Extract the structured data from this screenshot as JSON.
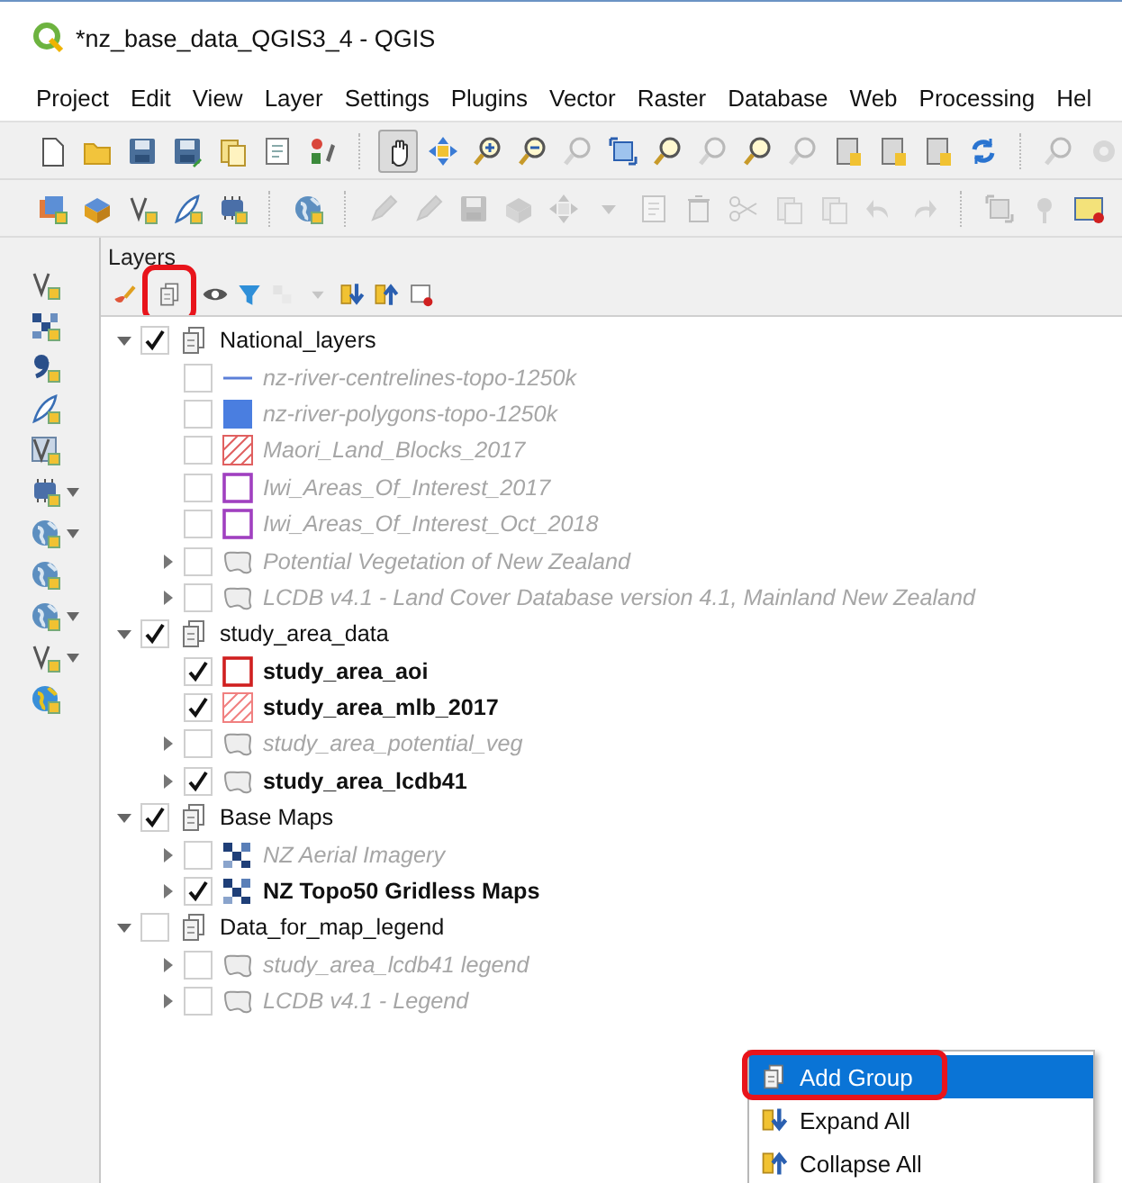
{
  "window": {
    "title": "*nz_base_data_QGIS3_4 - QGIS"
  },
  "menu_bar": [
    "Project",
    "Edit",
    "View",
    "Layer",
    "Settings",
    "Plugins",
    "Vector",
    "Raster",
    "Database",
    "Web",
    "Processing",
    "Hel"
  ],
  "toolbars": [
    [
      [
        {
          "kind": "page",
          "disabled": false,
          "pressed": false
        },
        {
          "kind": "folder",
          "disabled": false,
          "pressed": false
        },
        {
          "kind": "disk",
          "disabled": false,
          "pressed": false
        },
        {
          "kind": "diskpencil",
          "disabled": false,
          "pressed": false
        },
        {
          "kind": "pages",
          "disabled": false,
          "pressed": false
        },
        {
          "kind": "document",
          "disabled": false,
          "pressed": false
        },
        {
          "kind": "style",
          "disabled": false,
          "pressed": false
        }
      ],
      [
        {
          "kind": "hand",
          "disabled": false,
          "pressed": true
        },
        {
          "kind": "arrows",
          "disabled": false,
          "pressed": false
        },
        {
          "kind": "zoomin",
          "disabled": false,
          "pressed": false
        },
        {
          "kind": "zoomout",
          "disabled": false,
          "pressed": false
        },
        {
          "kind": "magnifier",
          "disabled": true,
          "pressed": false
        },
        {
          "kind": "frame",
          "disabled": false,
          "pressed": false
        },
        {
          "kind": "magnifier",
          "disabled": false,
          "pressed": false
        },
        {
          "kind": "magnifier",
          "disabled": true,
          "pressed": false
        },
        {
          "kind": "magnifier",
          "disabled": false,
          "pressed": false
        },
        {
          "kind": "magnifier",
          "disabled": true,
          "pressed": false
        },
        {
          "kind": "bookmark",
          "disabled": false,
          "pressed": false
        },
        {
          "kind": "bookmark",
          "disabled": false,
          "pressed": false
        },
        {
          "kind": "bookmark",
          "disabled": false,
          "pressed": false
        },
        {
          "kind": "refresh",
          "disabled": false,
          "pressed": false
        }
      ],
      [
        {
          "kind": "magnifier",
          "disabled": true,
          "pressed": false
        },
        {
          "kind": "gear",
          "disabled": true,
          "pressed": false
        }
      ]
    ],
    [
      [
        {
          "kind": "layers",
          "disabled": false,
          "pressed": false
        },
        {
          "kind": "box",
          "disabled": false,
          "pressed": false
        },
        {
          "kind": "vector",
          "disabled": false,
          "pressed": false
        },
        {
          "kind": "feather",
          "disabled": false,
          "pressed": false
        },
        {
          "kind": "chip",
          "disabled": false,
          "pressed": false
        }
      ],
      [
        {
          "kind": "globe",
          "disabled": false,
          "pressed": false
        }
      ],
      [
        {
          "kind": "pencil",
          "disabled": true,
          "pressed": false
        },
        {
          "kind": "pencil",
          "disabled": true,
          "pressed": false
        },
        {
          "kind": "disk",
          "disabled": true,
          "pressed": false
        },
        {
          "kind": "box",
          "disabled": true,
          "pressed": false
        },
        {
          "kind": "arrows",
          "disabled": true,
          "pressed": false
        },
        {
          "kind": "caret",
          "disabled": true,
          "pressed": false
        },
        {
          "kind": "document",
          "disabled": true,
          "pressed": false
        },
        {
          "kind": "trash",
          "disabled": true,
          "pressed": false
        },
        {
          "kind": "scissors",
          "disabled": true,
          "pressed": false
        },
        {
          "kind": "pages",
          "disabled": true,
          "pressed": false
        },
        {
          "kind": "pages",
          "disabled": true,
          "pressed": false
        },
        {
          "kind": "undo",
          "disabled": true,
          "pressed": false
        },
        {
          "kind": "redo",
          "disabled": true,
          "pressed": false
        }
      ],
      [
        {
          "kind": "frame",
          "disabled": true,
          "pressed": false
        },
        {
          "kind": "pin",
          "disabled": true,
          "pressed": false
        },
        {
          "kind": "label",
          "disabled": false,
          "pressed": false
        }
      ]
    ]
  ],
  "side_toolbar": [
    {
      "kind": "vector",
      "dropdown": false
    },
    {
      "kind": "checker",
      "dropdown": false
    },
    {
      "kind": "comma",
      "dropdown": false
    },
    {
      "kind": "feather",
      "dropdown": false
    },
    {
      "kind": "vbox",
      "dropdown": false
    },
    {
      "kind": "chip",
      "dropdown": true
    },
    {
      "kind": "globe",
      "dropdown": true
    },
    {
      "kind": "globe",
      "dropdown": false
    },
    {
      "kind": "globe",
      "dropdown": true
    },
    {
      "kind": "vector",
      "dropdown": true
    },
    {
      "kind": "earth",
      "dropdown": false
    }
  ],
  "layers_panel": {
    "title": "Layers",
    "toolbar": [
      {
        "kind": "brush",
        "highlighted": false,
        "disabled": false
      },
      {
        "kind": "group",
        "highlighted": true,
        "disabled": false
      },
      {
        "kind": "eye",
        "highlighted": false,
        "disabled": false
      },
      {
        "kind": "funnel",
        "highlighted": false,
        "disabled": false
      },
      {
        "kind": "filter",
        "highlighted": false,
        "disabled": true
      },
      {
        "kind": "caret",
        "highlighted": false,
        "disabled": true
      },
      {
        "kind": "expand",
        "highlighted": false,
        "disabled": false
      },
      {
        "kind": "collapse",
        "highlighted": false,
        "disabled": false
      },
      {
        "kind": "remove",
        "highlighted": false,
        "disabled": false
      }
    ],
    "tree": [
      {
        "kind": "group",
        "label": "National_layers",
        "checked": true,
        "expanded": true,
        "children": [
          {
            "kind": "line",
            "label": "nz-river-centrelines-topo-1250k",
            "checked": false,
            "color": "#5b7fd8"
          },
          {
            "kind": "fill",
            "label": "nz-river-polygons-topo-1250k",
            "checked": false,
            "color": "#4a7ee0"
          },
          {
            "kind": "hatch",
            "label": "Maori_Land_Blocks_2017",
            "checked": false,
            "color": "#e06060"
          },
          {
            "kind": "outline",
            "label": "Iwi_Areas_Of_Interest_2017",
            "checked": false,
            "color": "#a040c0"
          },
          {
            "kind": "outline",
            "label": "Iwi_Areas_Of_Interest_Oct_2018",
            "checked": false,
            "color": "#a040c0"
          },
          {
            "kind": "shape",
            "label": "Potential Vegetation of New Zealand",
            "checked": false,
            "expanded": false
          },
          {
            "kind": "shape",
            "label": "LCDB v4.1 - Land Cover Database version 4.1, Mainland New Zealand",
            "checked": false,
            "expanded": false
          }
        ]
      },
      {
        "kind": "group",
        "label": "study_area_data",
        "checked": true,
        "expanded": true,
        "children": [
          {
            "kind": "outline",
            "label": "study_area_aoi",
            "checked": true,
            "color": "#d02020"
          },
          {
            "kind": "hatch",
            "label": "study_area_mlb_2017",
            "checked": true,
            "color": "#f08080"
          },
          {
            "kind": "shape",
            "label": "study_area_potential_veg",
            "checked": false,
            "expanded": false
          },
          {
            "kind": "shape",
            "label": "study_area_lcdb41",
            "checked": true,
            "expanded": false
          }
        ]
      },
      {
        "kind": "group",
        "label": "Base Maps",
        "checked": true,
        "expanded": true,
        "children": [
          {
            "kind": "raster",
            "label": "NZ Aerial Imagery",
            "checked": false,
            "expanded": false
          },
          {
            "kind": "raster",
            "label": "NZ Topo50 Gridless Maps",
            "checked": true,
            "expanded": false
          }
        ]
      },
      {
        "kind": "group",
        "label": "Data_for_map_legend",
        "checked": false,
        "expanded": true,
        "children": [
          {
            "kind": "shape",
            "label": "study_area_lcdb41 legend",
            "checked": false,
            "expanded": false
          },
          {
            "kind": "shape",
            "label": "LCDB v4.1 - Legend",
            "checked": false,
            "expanded": false
          }
        ]
      }
    ]
  },
  "context_menu": [
    {
      "label": "Add Group",
      "selected": true,
      "highlighted": true
    },
    {
      "label": "Expand All",
      "selected": false,
      "highlighted": false
    },
    {
      "label": "Collapse All",
      "selected": false,
      "highlighted": false
    }
  ]
}
